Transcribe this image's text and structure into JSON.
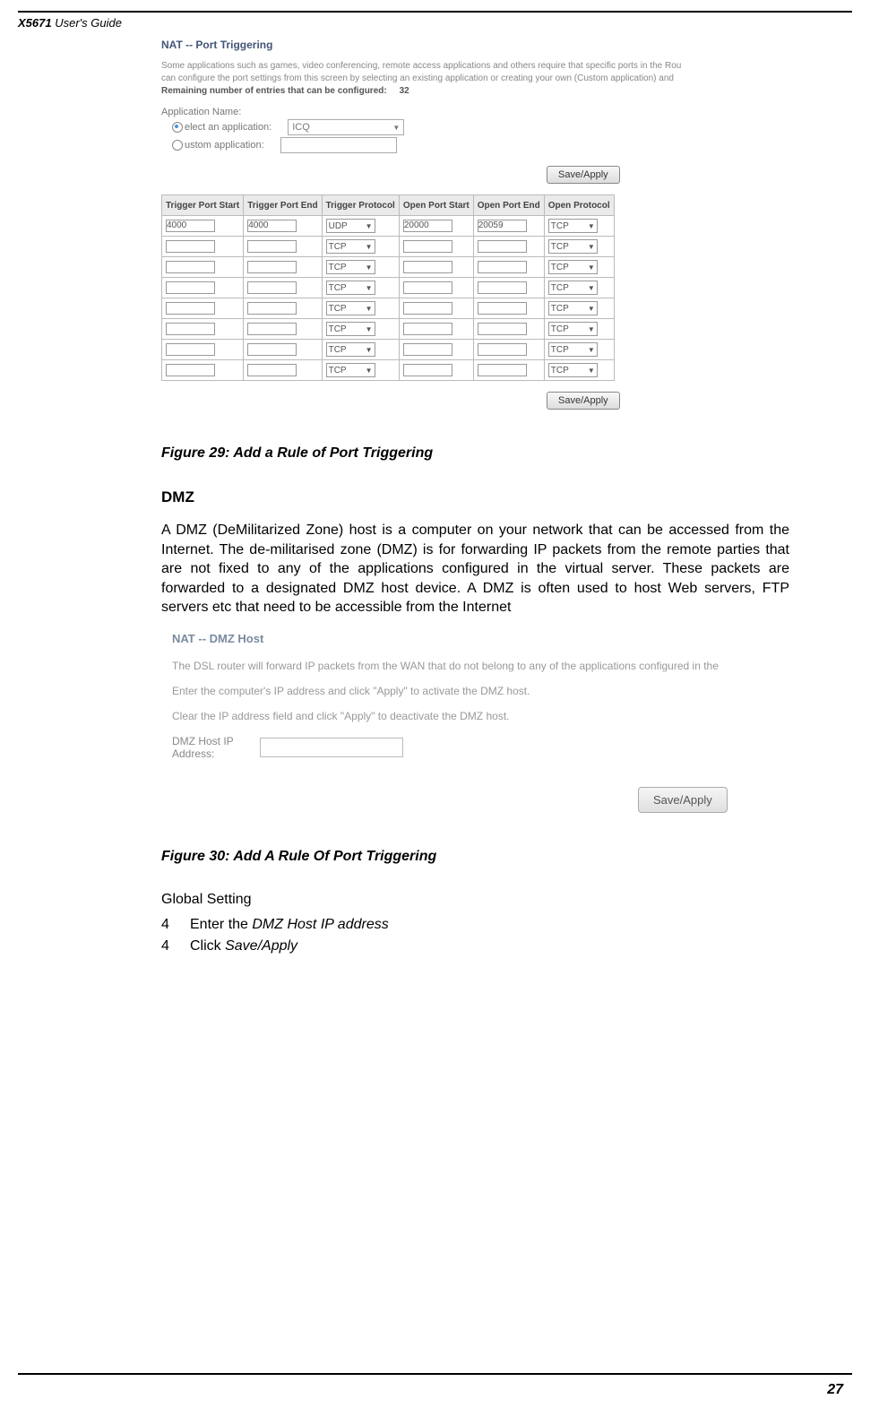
{
  "header": {
    "product": "X5671",
    "title_rest": " User's Guide"
  },
  "screenshot1": {
    "title": "NAT -- Port Triggering",
    "desc_line1": "Some applications such as games, video conferencing, remote access applications and others require that specific ports in the Rou",
    "desc_line2": "can configure the port settings from this screen by selecting an existing application or creating your own (Custom application) and",
    "remaining_label": "Remaining number of entries that can be configured:",
    "remaining_value": "32",
    "app_name_label": "Application Name:",
    "select_label": "elect an application:",
    "custom_label": "ustom application:",
    "select_value": "ICQ",
    "save_btn": "Save/Apply",
    "headers": {
      "c1": "Trigger Port Start",
      "c2": "Trigger Port End",
      "c3": "Trigger Protocol",
      "c4": "Open Port Start",
      "c5": "Open Port End",
      "c6": "Open Protocol"
    },
    "rows": [
      {
        "tps": "4000",
        "tpe": "4000",
        "tproto": "UDP",
        "ops": "20000",
        "ope": "20059",
        "oproto": "TCP"
      },
      {
        "tps": "",
        "tpe": "",
        "tproto": "TCP",
        "ops": "",
        "ope": "",
        "oproto": "TCP"
      },
      {
        "tps": "",
        "tpe": "",
        "tproto": "TCP",
        "ops": "",
        "ope": "",
        "oproto": "TCP"
      },
      {
        "tps": "",
        "tpe": "",
        "tproto": "TCP",
        "ops": "",
        "ope": "",
        "oproto": "TCP"
      },
      {
        "tps": "",
        "tpe": "",
        "tproto": "TCP",
        "ops": "",
        "ope": "",
        "oproto": "TCP"
      },
      {
        "tps": "",
        "tpe": "",
        "tproto": "TCP",
        "ops": "",
        "ope": "",
        "oproto": "TCP"
      },
      {
        "tps": "",
        "tpe": "",
        "tproto": "TCP",
        "ops": "",
        "ope": "",
        "oproto": "TCP"
      },
      {
        "tps": "",
        "tpe": "",
        "tproto": "TCP",
        "ops": "",
        "ope": "",
        "oproto": "TCP"
      }
    ]
  },
  "fig29": "Figure 29: Add a Rule of Port Triggering",
  "dmz": {
    "heading": "DMZ",
    "body": "A DMZ (DeMilitarized Zone) host is a computer on your network that can be accessed from the Internet. The de-militarised zone (DMZ) is for forwarding IP packets from the remote parties that are not fixed to any of the applications configured in the virtual server. These packets are forwarded to a designated DMZ host device. A DMZ is often used to host Web servers, FTP servers etc that need to be accessible from the Internet"
  },
  "screenshot2": {
    "title": "NAT -- DMZ Host",
    "line1": "The DSL router will forward IP packets from the WAN that do not belong to any of the applications configured in the",
    "line2": "Enter the computer's IP address and click \"Apply\" to activate the DMZ host.",
    "line3": "Clear the IP address field and click \"Apply\" to deactivate the DMZ host.",
    "label": "DMZ Host IP Address:",
    "btn": "Save/Apply"
  },
  "fig30": "Figure 30: Add A Rule Of Port Triggering",
  "global_setting": "Global Setting",
  "steps": {
    "s1_num": "4",
    "s1_pre": "Enter the ",
    "s1_ital": "DMZ Host IP address",
    "s2_num": "4",
    "s2_pre": "Click ",
    "s2_ital": "Save/Apply"
  },
  "page_num": "27"
}
